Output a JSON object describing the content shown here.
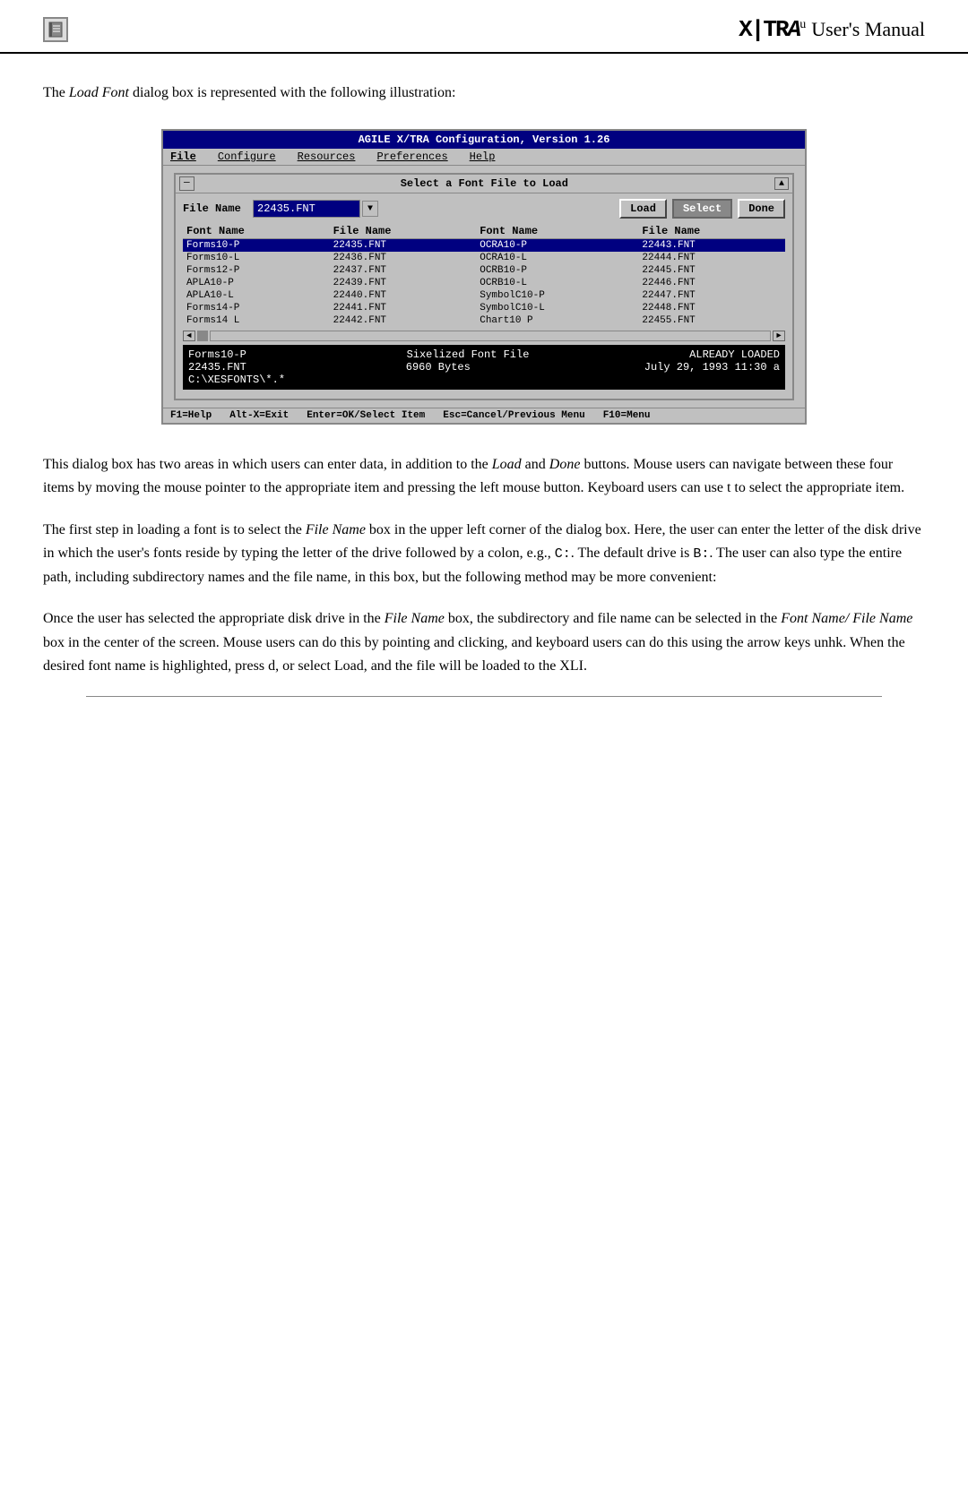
{
  "header": {
    "brand": "X|TRA",
    "subtitle": "User's Manual",
    "icon_label": "book-icon"
  },
  "intro": {
    "text": "The ",
    "italic_text": "Load Font",
    "rest": " dialog box is represented with the following illustration:"
  },
  "dialog": {
    "app_title": "AGILE X/TRA Configuration, Version 1.26",
    "menu_items": [
      "File",
      "Configure",
      "Resources",
      "Preferences",
      "Help"
    ],
    "inner_title": "Select a Font File to Load",
    "file_name_label": "File Name",
    "file_name_value": "22435.FNT",
    "btn_load": "Load",
    "btn_select": "Select",
    "btn_done": "Done",
    "col_headers": [
      "Font Name",
      "File Name",
      "Font Name",
      "File Name"
    ],
    "rows": [
      {
        "font1": "Forms10-P",
        "file1": "22435.FNT",
        "font2": "OCRA10-P",
        "file2": "22443.FNT",
        "selected": true
      },
      {
        "font1": "Forms10-L",
        "file1": "22436.FNT",
        "font2": "OCRA10-L",
        "file2": "22444.FNT",
        "selected": false
      },
      {
        "font1": "Forms12-P",
        "file1": "22437.FNT",
        "font2": "OCRB10-P",
        "file2": "22445.FNT",
        "selected": false
      },
      {
        "font1": "APLA10-P",
        "file1": "22439.FNT",
        "font2": "OCRB10-L",
        "file2": "22446.FNT",
        "selected": false
      },
      {
        "font1": "APLA10-L",
        "file1": "22440.FNT",
        "font2": "SymbolC10-P",
        "file2": "22447.FNT",
        "selected": false
      },
      {
        "font1": "Forms14-P",
        "file1": "22441.FNT",
        "font2": "SymbolC10-L",
        "file2": "22448.FNT",
        "selected": false
      },
      {
        "font1": "Forms14 L",
        "file1": "22442.FNT",
        "font2": "Chart10 P",
        "file2": "22455.FNT",
        "selected": false
      }
    ],
    "status_line1_font": "Forms10-P",
    "status_line1_mid": "Sixelized Font File",
    "status_line1_right": "ALREADY LOADED",
    "status_line2_file": "22435.FNT",
    "status_line2_size": "6960 Bytes",
    "status_line2_date": "July 29, 1993 11:30 a",
    "status_line3_path": "C:\\XESFONTS\\*.*",
    "bottom_bar": [
      {
        "key": "F1=Help"
      },
      {
        "key": "Alt-X=Exit"
      },
      {
        "key": "Enter=OK/Select Item"
      },
      {
        "key": "Esc=Cancel/Previous Menu"
      },
      {
        "key": "F10=Menu"
      }
    ]
  },
  "paragraphs": [
    "This dialog box has two areas in which users can enter data, in addition to the Load and Done buttons. Mouse users can navigate between these four items by moving the mouse pointer to the appropriate item and pressing the left mouse button. Keyboard users can use t to select the appropriate item.",
    "The first step in loading a font is to select the File Name box in the upper left corner of the dialog box. Here, the user can enter the letter of the disk drive in which the user's fonts reside by typing the letter of the drive followed by a colon, e.g., C:. The default drive is B:. The user can also type the entire path, including subdirectory names and the file name, in this box, but the following method may be more convenient:",
    "Once the user has selected the appropriate disk drive in the File Name box, the subdirectory and file name can be selected in the Font Name/ File Name box in the center of the screen. Mouse users can do this by pointing and clicking, and keyboard users can do this using the arrow keys unhk. When the desired font name is highlighted, press d, or select Load, and the file will be loaded to the XLI."
  ]
}
